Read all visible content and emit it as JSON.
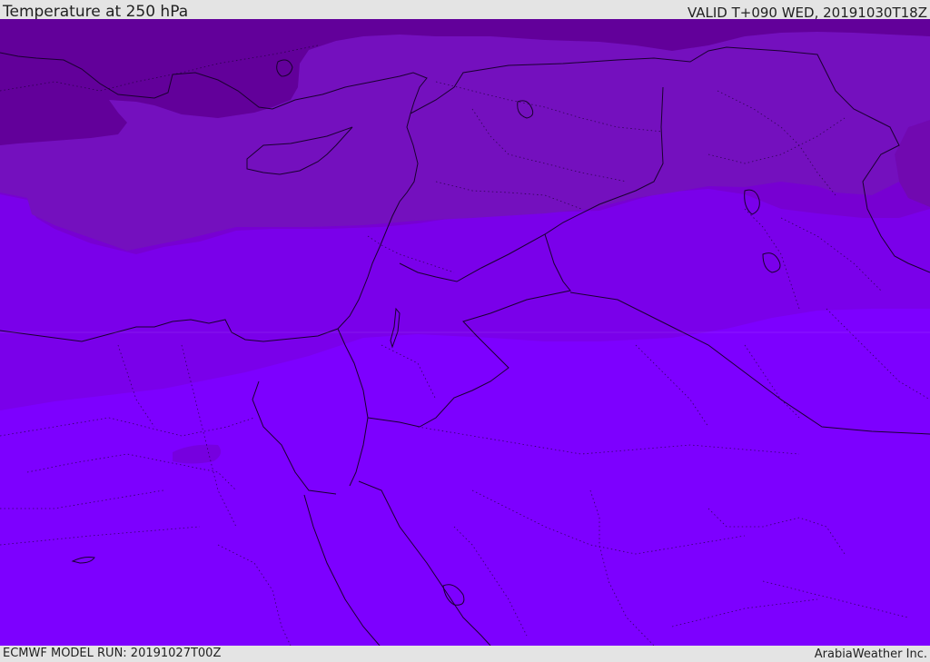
{
  "header": {
    "title": "Temperature at 250 hPa",
    "valid": "VALID T+090 WED, 20191030T18Z"
  },
  "footer": {
    "run": "ECMWF MODEL RUN: 20191027T00Z",
    "credit": "ArabiaWeather Inc."
  },
  "colors": {
    "band_coldest": "#62009a",
    "band_cold": "#7109b0",
    "band_mid": "#7700d2",
    "band_warm": "#7a00ea",
    "band_warmest": "#7d00ff",
    "lines": "#1a0030"
  }
}
